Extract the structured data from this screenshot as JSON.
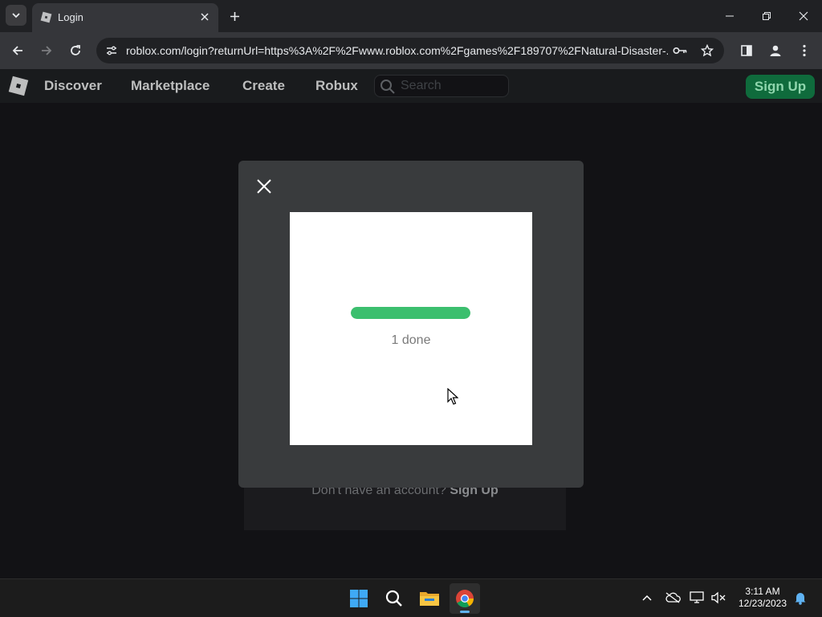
{
  "browser": {
    "tab_title": "Login",
    "url": "roblox.com/login?returnUrl=https%3A%2F%2Fwww.roblox.com%2Fgames%2F189707%2FNatural-Disaster-..."
  },
  "site_header": {
    "nav": [
      "Discover",
      "Marketplace",
      "Create",
      "Robux"
    ],
    "search_placeholder": "Search",
    "signup_label": "Sign Up"
  },
  "login_card": {
    "no_account_text": "Don't have an account?",
    "signup_link": "Sign Up"
  },
  "captcha": {
    "progress_fraction": 1.0,
    "status_text": "1 done"
  },
  "taskbar": {
    "time": "3:11 AM",
    "date": "12/23/2023"
  },
  "colors": {
    "progress_fill": "#3bbf6e",
    "signup_button": "#0f6b3c",
    "modal_bg": "#393b3d"
  },
  "icons": [
    "chevron-down-icon",
    "roblox-favicon-icon",
    "close-icon",
    "plus-icon",
    "minimize-icon",
    "restore-icon",
    "back-icon",
    "forward-icon",
    "reload-icon",
    "site-info-icon",
    "key-icon",
    "star-icon",
    "side-panel-icon",
    "profile-icon",
    "more-icon",
    "roblox-logo-icon",
    "search-icon",
    "windows-start-icon",
    "file-explorer-icon",
    "chrome-icon",
    "bell-icon"
  ]
}
